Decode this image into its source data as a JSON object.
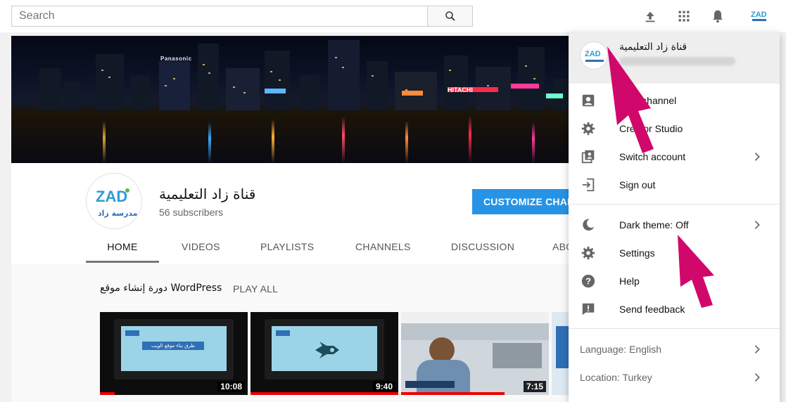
{
  "search": {
    "placeholder": "Search"
  },
  "header_icons": [
    "upload-icon",
    "apps-icon",
    "bell-icon",
    "account-avatar"
  ],
  "channel": {
    "name": "قناة زاد التعليمية",
    "subscribers": "56 subscribers",
    "customize_label": "CUSTOMIZE CHANNEL",
    "logo_text": "ZAD",
    "logo_subtext": "مدرسة زاد"
  },
  "banner": {
    "signs": [
      "HITACHI",
      "Panasonic"
    ]
  },
  "tabs": [
    {
      "label": "HOME",
      "active": true
    },
    {
      "label": "VIDEOS"
    },
    {
      "label": "PLAYLISTS"
    },
    {
      "label": "CHANNELS"
    },
    {
      "label": "DISCUSSION"
    },
    {
      "label": "ABOUT"
    }
  ],
  "shelf": {
    "title": "دورة إنشاء موقع WordPress",
    "play_all": "PLAY ALL",
    "videos": [
      {
        "duration": "10:08",
        "progress": 0.1,
        "screen_text": "طرق بناء موقع الويب"
      },
      {
        "duration": "9:40",
        "progress": 1.0
      },
      {
        "duration": "7:15",
        "progress": 0.7
      },
      {
        "duration": "",
        "progress": 0
      }
    ]
  },
  "account_menu": {
    "name": "قناة زاد التعليمية",
    "items": [
      {
        "label": "Your channel",
        "icon": "person-icon"
      },
      {
        "label": "Creator Studio",
        "icon": "gear-icon"
      },
      {
        "label": "Switch account",
        "icon": "switch-account-icon",
        "chevron": true
      },
      {
        "label": "Sign out",
        "icon": "sign-out-icon"
      },
      {
        "label": "Dark theme: Off",
        "icon": "moon-icon",
        "chevron": true
      },
      {
        "label": "Settings",
        "icon": "gear-icon"
      },
      {
        "label": "Help",
        "icon": "help-icon"
      },
      {
        "label": "Send feedback",
        "icon": "feedback-icon"
      },
      {
        "label": "Language: English",
        "chevron": true
      },
      {
        "label": "Location: Turkey",
        "chevron": true
      }
    ]
  },
  "colors": {
    "accent_blue": "#2793e6",
    "annotation_pink": "#d1086b",
    "progress_red": "#e00000"
  }
}
